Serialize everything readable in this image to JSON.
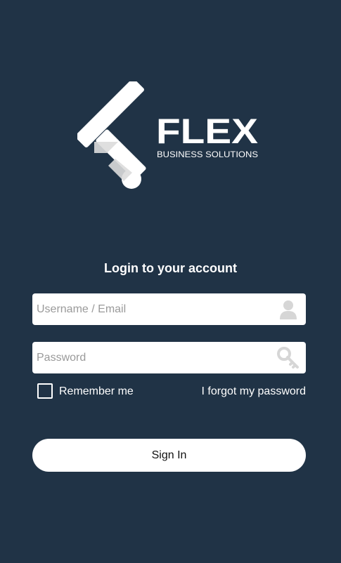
{
  "logo": {
    "wordmark": "FLEX",
    "tagline": "BUSINESS SOLUTIONS",
    "color": "#ffffff"
  },
  "colors": {
    "background": "#203346",
    "field_background": "#ffffff",
    "icon_gray": "#d3d3d3"
  },
  "login": {
    "title": "Login to your account",
    "username_placeholder": "Username / Email",
    "username_icon": "user-icon",
    "password_placeholder": "Password",
    "password_icon": "key-icon",
    "remember_label": "Remember me",
    "remember_checked": false,
    "forgot_label": "I forgot my password",
    "sign_in_label": "Sign In"
  }
}
